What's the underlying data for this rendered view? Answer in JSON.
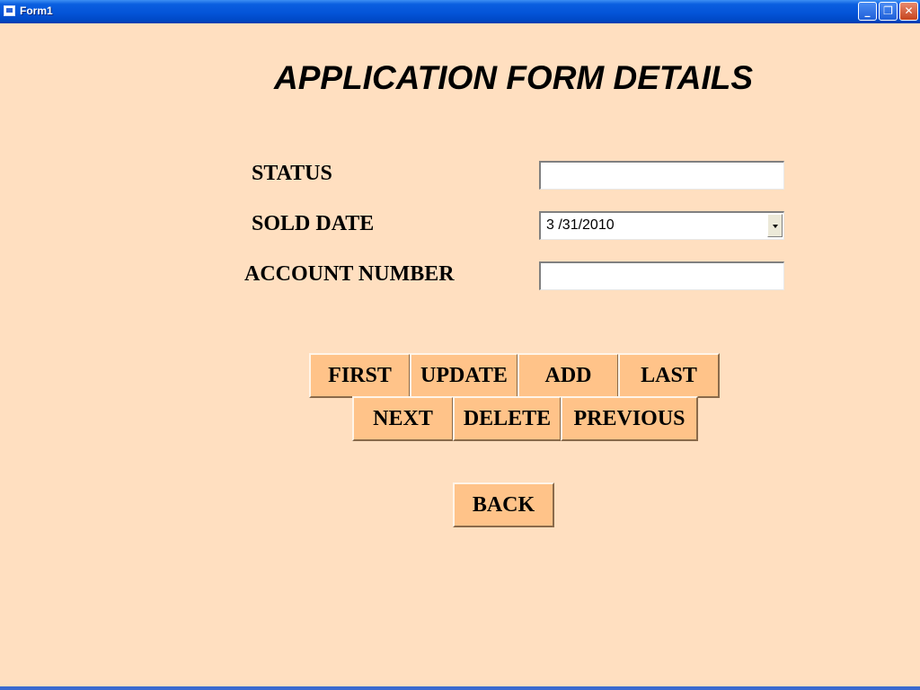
{
  "window": {
    "title": "Form1",
    "controls": {
      "minimize": "_",
      "maximize": "❐",
      "close": "✕"
    }
  },
  "form": {
    "heading": "APPLICATION FORM DETAILS",
    "fields": {
      "status_label": "STATUS",
      "status_value": "",
      "sold_date_label": "SOLD DATE",
      "sold_date_value": "3 /31/2010",
      "account_number_label": "ACCOUNT NUMBER",
      "account_number_value": ""
    },
    "buttons": {
      "first": "FIRST",
      "update": "UPDATE",
      "add": "ADD",
      "last": "LAST",
      "next": "NEXT",
      "delete": "DELETE",
      "previous": "PREVIOUS",
      "back": "BACK"
    }
  },
  "colors": {
    "form_background": "#FFDFC0",
    "button_face": "#FFC389",
    "titlebar_blue": "#0454D8"
  }
}
